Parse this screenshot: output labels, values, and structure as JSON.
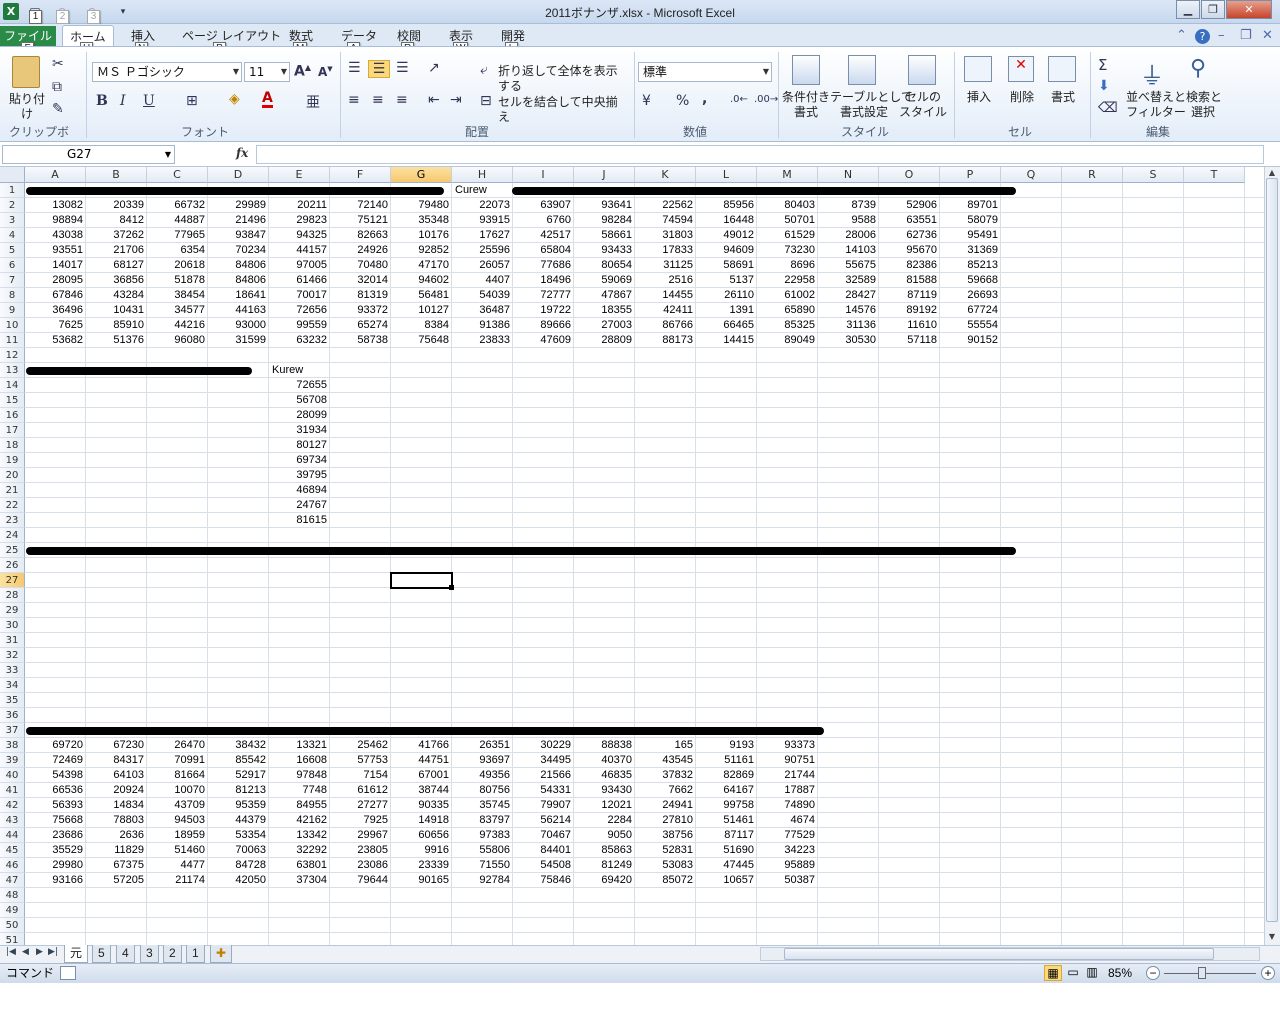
{
  "window": {
    "title": "2011ボナンザ.xlsx - Microsoft Excel",
    "app_icon": "X"
  },
  "qat_keytips": [
    "1",
    "2",
    "3"
  ],
  "tabs": [
    {
      "label": "ファイル",
      "keytip": "F",
      "active": false
    },
    {
      "label": "ホーム",
      "keytip": "H",
      "active": true
    },
    {
      "label": "挿入",
      "keytip": "N",
      "active": false
    },
    {
      "label": "ページ レイアウト",
      "keytip": "P",
      "active": false
    },
    {
      "label": "数式",
      "keytip": "M",
      "active": false
    },
    {
      "label": "データ",
      "keytip": "A",
      "active": false
    },
    {
      "label": "校閲",
      "keytip": "R",
      "active": false
    },
    {
      "label": "表示",
      "keytip": "W",
      "active": false
    },
    {
      "label": "開発",
      "keytip": "L",
      "active": false
    }
  ],
  "ribbon": {
    "clipboard": {
      "paste": "貼り付け",
      "label": "クリップボード"
    },
    "font": {
      "name": "ＭＳ Ｐゴシック",
      "size": "11",
      "label": "フォント",
      "bold": "B",
      "italic": "I",
      "underline": "U"
    },
    "alignment": {
      "wrap": "折り返して全体を表示する",
      "merge": "セルを結合して中央揃え",
      "label": "配置"
    },
    "number": {
      "format": "標準",
      "label": "数値",
      "percent": "%",
      "comma": ","
    },
    "styles": {
      "conditional": "条件付き\n書式",
      "table": "テーブルとして\n書式設定",
      "cell": "セルの\nスタイル",
      "label": "スタイル"
    },
    "cells": {
      "insert": "挿入",
      "delete": "削除",
      "format": "書式",
      "label": "セル"
    },
    "editing": {
      "sort": "並べ替えと\nフィルター",
      "find": "検索と\n選択",
      "label": "編集"
    }
  },
  "formula_bar": {
    "name_box": "G27",
    "fx": "fx",
    "formula": ""
  },
  "columns": [
    "A",
    "B",
    "C",
    "D",
    "E",
    "F",
    "G",
    "H",
    "I",
    "J",
    "K",
    "L",
    "M",
    "N",
    "O",
    "P",
    "Q",
    "R",
    "S",
    "T"
  ],
  "selected_cell": {
    "col": "G",
    "row": 27
  },
  "header_text": {
    "H1": "Curew",
    "E13": "Kurew"
  },
  "table1": [
    [
      13082,
      20339,
      66732,
      29989,
      20211,
      72140,
      79480,
      22073,
      63907,
      93641,
      22562,
      85956,
      80403,
      8739,
      52906,
      89701
    ],
    [
      98894,
      8412,
      44887,
      21496,
      29823,
      75121,
      35348,
      93915,
      6760,
      98284,
      74594,
      16448,
      50701,
      9588,
      63551,
      58079
    ],
    [
      43038,
      37262,
      77965,
      93847,
      94325,
      82663,
      10176,
      17627,
      42517,
      58661,
      31803,
      49012,
      61529,
      28006,
      62736,
      95491
    ],
    [
      93551,
      21706,
      6354,
      70234,
      44157,
      24926,
      92852,
      25596,
      65804,
      93433,
      17833,
      94609,
      73230,
      14103,
      95670,
      31369
    ],
    [
      14017,
      68127,
      20618,
      84806,
      97005,
      70480,
      47170,
      26057,
      77686,
      80654,
      31125,
      58691,
      8696,
      55675,
      82386,
      85213
    ],
    [
      28095,
      36856,
      51878,
      84806,
      61466,
      32014,
      94602,
      4407,
      18496,
      59069,
      2516,
      5137,
      22958,
      32589,
      81588,
      59668
    ],
    [
      67846,
      43284,
      38454,
      18641,
      70017,
      81319,
      56481,
      54039,
      72777,
      47867,
      14455,
      26110,
      61002,
      28427,
      87119,
      26693
    ],
    [
      36496,
      10431,
      34577,
      44163,
      72656,
      93372,
      10127,
      36487,
      19722,
      18355,
      42411,
      1391,
      65890,
      14576,
      89192,
      67724
    ],
    [
      7625,
      85910,
      44216,
      93000,
      99559,
      65274,
      8384,
      91386,
      89666,
      27003,
      86766,
      66465,
      85325,
      31136,
      11610,
      55554
    ],
    [
      53682,
      51376,
      96080,
      31599,
      63232,
      58738,
      75648,
      23833,
      47609,
      28809,
      88173,
      14415,
      89049,
      30530,
      57118,
      90152
    ]
  ],
  "table2": [
    72655,
    56708,
    28099,
    31934,
    80127,
    69734,
    39795,
    46894,
    24767,
    81615
  ],
  "table3": [
    [
      69720,
      67230,
      26470,
      38432,
      13321,
      25462,
      41766,
      26351,
      30229,
      88838,
      165,
      9193,
      93373
    ],
    [
      72469,
      84317,
      70991,
      85542,
      16608,
      57753,
      44751,
      93697,
      34495,
      40370,
      43545,
      51161,
      90751
    ],
    [
      54398,
      64103,
      81664,
      52917,
      97848,
      7154,
      67001,
      49356,
      21566,
      46835,
      37832,
      82869,
      21744
    ],
    [
      66536,
      20924,
      10070,
      81213,
      7748,
      61612,
      38744,
      80756,
      54331,
      93430,
      7662,
      64167,
      17887
    ],
    [
      56393,
      14834,
      43709,
      95359,
      84955,
      27277,
      90335,
      35745,
      79907,
      12021,
      24941,
      99758,
      74890
    ],
    [
      75668,
      78803,
      94503,
      44379,
      42162,
      7925,
      14918,
      83797,
      56214,
      2284,
      27810,
      51461,
      4674
    ],
    [
      23686,
      2636,
      18959,
      53354,
      13342,
      29967,
      60656,
      97383,
      70467,
      9050,
      38756,
      87117,
      77529
    ],
    [
      35529,
      11829,
      51460,
      70063,
      32292,
      23805,
      9916,
      55806,
      84401,
      85863,
      52831,
      51690,
      34223
    ],
    [
      29980,
      67375,
      4477,
      84728,
      63801,
      23086,
      23339,
      71550,
      54508,
      81249,
      53083,
      47445,
      95889
    ],
    [
      93166,
      57205,
      21174,
      42050,
      37304,
      79644,
      90165,
      92784,
      75846,
      69420,
      85072,
      10657,
      50387
    ]
  ],
  "sheets": [
    {
      "name": "元",
      "active": true
    },
    {
      "name": "5",
      "active": false
    },
    {
      "name": "4",
      "active": false
    },
    {
      "name": "3",
      "active": false
    },
    {
      "name": "2",
      "active": false
    },
    {
      "name": "1",
      "active": false
    }
  ],
  "status": {
    "mode": "コマンド",
    "zoom": "85%"
  },
  "colors": {
    "accent": "#2a8a48",
    "selection": "#f6c870"
  }
}
